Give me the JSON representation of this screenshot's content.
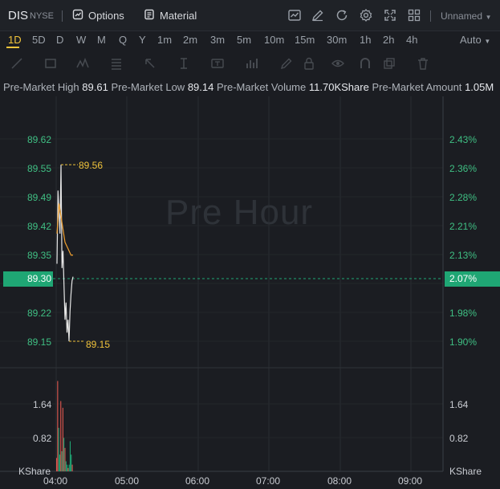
{
  "header": {
    "symbol": "DIS",
    "exchange": "NYSE",
    "options_label": "Options",
    "material_label": "Material",
    "layout_name": "Unnamed",
    "icons": [
      "chart-icon",
      "edit-icon",
      "refresh-icon",
      "settings-icon",
      "fullscreen-icon",
      "grid-layout-icon"
    ]
  },
  "periods": {
    "items": [
      "1D",
      "5D",
      "D",
      "W",
      "M",
      "Q",
      "Y",
      "1m",
      "2m",
      "3m",
      "5m",
      "10m",
      "15m",
      "30m",
      "1h",
      "2h",
      "4h"
    ],
    "active": "1D",
    "mode": "Auto"
  },
  "stats": {
    "high_label": "Pre-Market High",
    "high": "89.61",
    "low_label": "Pre-Market Low",
    "low": "89.14",
    "volume_label": "Pre-Market Volume",
    "volume": "11.70KShare",
    "amount_label": "Pre-Market Amount",
    "amount": "1.05M"
  },
  "chart": {
    "watermark": "Pre Hour",
    "current_price": "89.30",
    "current_pct": "2.07%",
    "high_annotation": "89.56",
    "low_annotation": "89.15",
    "price_ticks": [
      "89.62",
      "89.55",
      "89.49",
      "89.42",
      "89.35",
      "89.22",
      "89.15"
    ],
    "pct_ticks": [
      "2.43%",
      "2.36%",
      "2.28%",
      "2.21%",
      "2.13%",
      "1.98%",
      "1.90%"
    ],
    "volume_ticks": [
      "1.64",
      "0.82"
    ],
    "volume_unit": "KShare",
    "time_ticks": [
      "04:00",
      "05:00",
      "06:00",
      "07:00",
      "08:00",
      "09:00"
    ],
    "colors": {
      "up": "#1fa674",
      "down": "#e0574f",
      "accent": "#f0c33b",
      "line": "#e6e6e6",
      "avg": "#f0a030"
    }
  },
  "chart_data": {
    "type": "line",
    "title": "",
    "xlabel": "",
    "ylabel": "",
    "ylim": [
      89.12,
      89.65
    ],
    "series": [
      {
        "name": "",
        "x": [
          "04:00",
          "04:01",
          "04:02",
          "04:03",
          "04:04",
          "04:05",
          "04:06",
          "04:07",
          "04:08",
          "04:09",
          "04:10",
          "04:11",
          "04:12",
          "04:13",
          "04:14",
          "04:15",
          "04:16"
        ],
        "values": [
          89.33,
          89.5,
          89.45,
          89.4,
          89.56,
          89.32,
          89.36,
          89.28,
          89.2,
          89.24,
          89.17,
          89.2,
          89.15,
          89.22,
          89.26,
          89.29,
          89.3
        ]
      },
      {
        "name": "",
        "x": [
          "04:00",
          "04:02",
          "04:04",
          "04:06",
          "04:08",
          "04:10",
          "04:12",
          "04:14",
          "04:16"
        ],
        "values": [
          89.4,
          89.47,
          89.44,
          89.41,
          89.38,
          89.37,
          89.36,
          89.35,
          89.35
        ]
      }
    ],
    "volume_bars": [
      0.4,
      2.7,
      1.3,
      0.5,
      2.1,
      0.6,
      1.9,
      1.0,
      0.7,
      0.3,
      0.2,
      0.1,
      0.2,
      0.9,
      0.5,
      0.2
    ],
    "volume_bar_colors": [
      "down",
      "down",
      "up",
      "up",
      "down",
      "up",
      "down",
      "up",
      "down",
      "up",
      "up",
      "down",
      "up",
      "up",
      "up",
      "down"
    ]
  }
}
